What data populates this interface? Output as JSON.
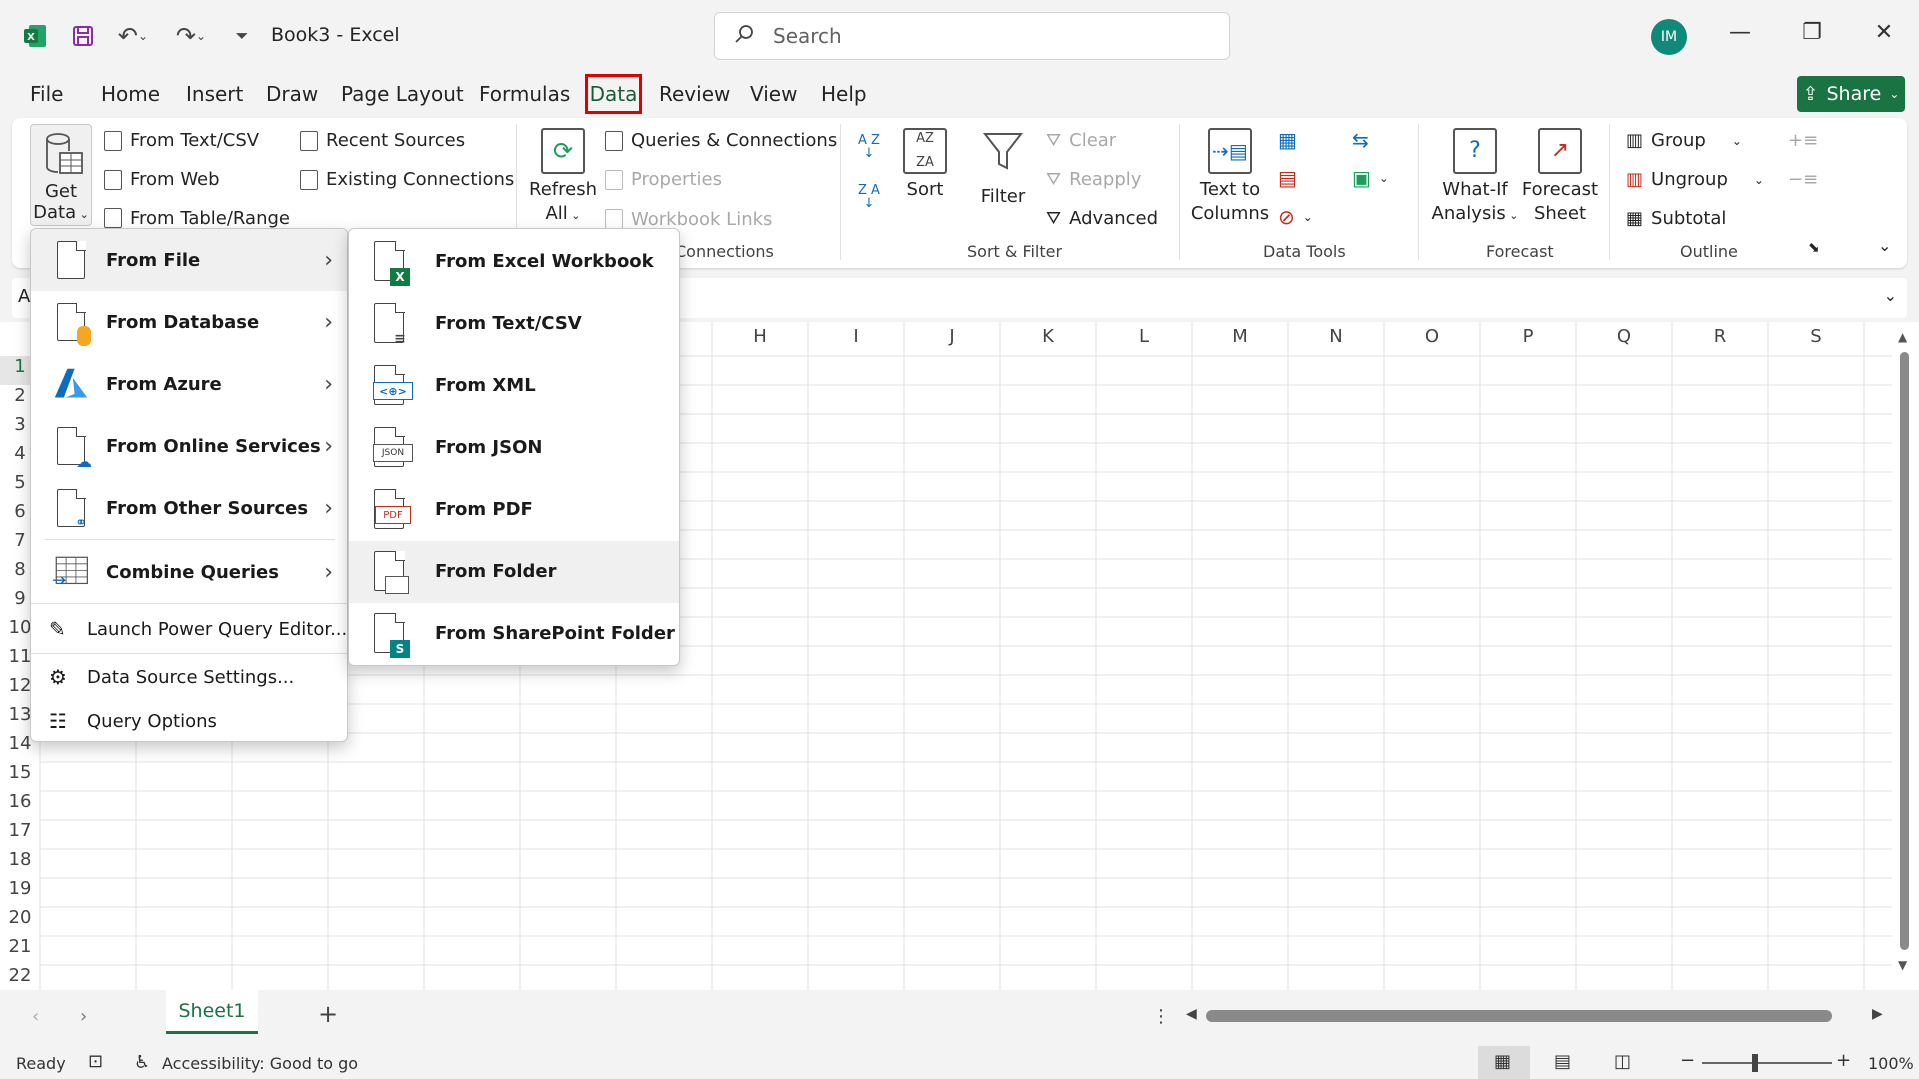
{
  "app": {
    "doc_title": "Book3",
    "app_name": "Excel",
    "separator": " - "
  },
  "search": {
    "placeholder": "Search"
  },
  "avatar": {
    "initials": "IM"
  },
  "menubar": {
    "tabs": [
      "File",
      "Home",
      "Insert",
      "Draw",
      "Page Layout",
      "Formulas",
      "Data",
      "Review",
      "View",
      "Help"
    ],
    "active": "Data"
  },
  "share": {
    "label": "Share"
  },
  "ribbon": {
    "get_data": {
      "line1": "Get",
      "line2": "Data"
    },
    "get_transform": {
      "from_text_csv": "From Text/CSV",
      "from_web": "From Web",
      "from_table_range": "From Table/Range",
      "recent_sources": "Recent Sources",
      "existing_connections": "Existing Connections"
    },
    "queries": {
      "refresh_line1": "Refresh",
      "refresh_line2": "All",
      "queries_connections": "Queries & Connections",
      "properties": "Properties",
      "workbook_links": "Workbook Links",
      "group_label": "Connections"
    },
    "sort_filter": {
      "az": "A Z",
      "za": "Z A",
      "sort": "Sort",
      "filter": "Filter",
      "clear": "Clear",
      "reapply": "Reapply",
      "advanced": "Advanced",
      "group_label": "Sort & Filter"
    },
    "data_tools": {
      "text_to_columns_1": "Text to",
      "text_to_columns_2": "Columns",
      "group_label": "Data Tools"
    },
    "forecast": {
      "what_if_1": "What-If",
      "what_if_2": "Analysis",
      "forecast_sheet_1": "Forecast",
      "forecast_sheet_2": "Sheet",
      "group_label": "Forecast"
    },
    "outline": {
      "group": "Group",
      "ungroup": "Ungroup",
      "subtotal": "Subtotal",
      "group_label": "Outline"
    }
  },
  "namebox": {
    "value": "A"
  },
  "grid": {
    "columns": [
      "H",
      "I",
      "J",
      "K",
      "L",
      "M",
      "N",
      "O",
      "P",
      "Q",
      "R",
      "S"
    ],
    "rows": [
      "1",
      "2",
      "3",
      "4",
      "5",
      "6",
      "7",
      "8",
      "9",
      "10",
      "11",
      "12",
      "13",
      "14",
      "15",
      "16",
      "17",
      "18",
      "19",
      "20",
      "21",
      "22"
    ]
  },
  "get_data_menu": {
    "items": [
      {
        "label": "From File",
        "has_submenu": true
      },
      {
        "label": "From Database",
        "has_submenu": true
      },
      {
        "label": "From Azure",
        "has_submenu": true
      },
      {
        "label": "From Online Services",
        "has_submenu": true
      },
      {
        "label": "From Other Sources",
        "has_submenu": true
      },
      {
        "label": "Combine Queries",
        "has_submenu": true
      }
    ],
    "footer": [
      "Launch Power Query Editor...",
      "Data Source Settings...",
      "Query Options"
    ]
  },
  "from_file_menu": {
    "items": [
      "From Excel Workbook",
      "From Text/CSV",
      "From XML",
      "From JSON",
      "From PDF",
      "From Folder",
      "From SharePoint Folder"
    ],
    "hovered": "From Folder"
  },
  "sheets": {
    "active": "Sheet1"
  },
  "status": {
    "ready": "Ready",
    "accessibility": "Accessibility: Good to go",
    "zoom": "100%"
  },
  "colors": {
    "accent_green": "#1a7343",
    "highlight_red": "#e00000",
    "excel_green": "#107c41"
  }
}
